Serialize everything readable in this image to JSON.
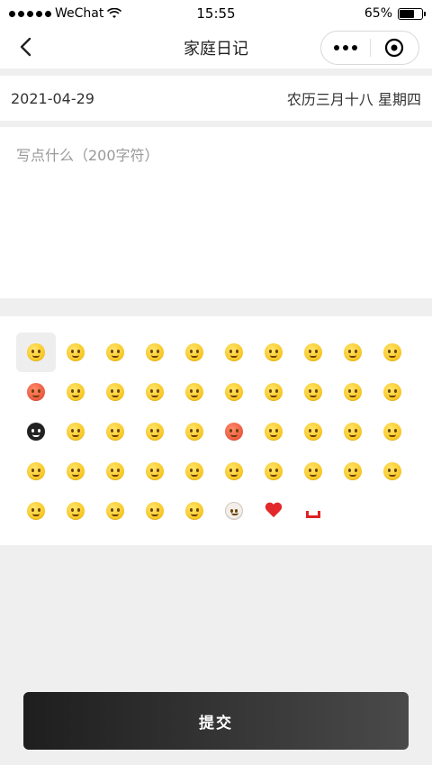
{
  "status_bar": {
    "carrier": "WeChat",
    "time": "15:55",
    "battery": "65%",
    "icons": [
      "signal-dots-icon",
      "wifi-icon",
      "battery-icon"
    ]
  },
  "navbar": {
    "title": "家庭日记",
    "back_icon": "chevron-left-icon",
    "more_icon": "more-dots-icon",
    "close_icon": "target-close-icon"
  },
  "date_bar": {
    "date": "2021-04-29",
    "lunar": "农历三月十八 星期四"
  },
  "editor": {
    "value": "",
    "placeholder": "写点什么（200字符）"
  },
  "emoji_panel": {
    "selected_index": 0,
    "items": [
      "grin-face-icon",
      "crying-laugh-icon",
      "smile-face-icon",
      "shy-face-icon",
      "blush-face-icon",
      "surprised-face-icon",
      "kiss-face-icon",
      "wink-face-icon",
      "sneeze-face-icon",
      "happy-face-icon",
      "angry-face-icon",
      "tears-face-icon",
      "thinking-face-icon",
      "tongue-face-icon",
      "bandage-face-icon",
      "hug-face-icon",
      "confused-face-icon",
      "smirk-face-icon",
      "squint-face-icon",
      "shocked-face-icon",
      "skull-face-icon",
      "sad-face-icon",
      "scared-face-icon",
      "giggle-face-icon",
      "cheer-face-icon",
      "mask-face-icon",
      "question-face-icon",
      "pout-face-icon",
      "drool-face-icon",
      "worried-face-icon",
      "neutral-face-icon",
      "dizzy-face-icon",
      "sleepy-face-icon",
      "sweat-face-icon",
      "wow-face-icon",
      "cool-face-icon",
      "love-eyes-icon",
      "shrug-face-icon",
      "ok-face-icon",
      "star-eyes-icon",
      "cute-face-icon",
      "laughing-face-icon",
      "peek-face-icon",
      "grimace-face-icon",
      "groan-face-icon",
      "pig-face-icon",
      "red-heart-icon",
      "gift-partial-icon"
    ]
  },
  "submit": {
    "label": "提交"
  },
  "colors": {
    "page_bg": "#efefef",
    "button_dark": "#1e1e1e",
    "emoji_yellow": "#f5b800"
  }
}
